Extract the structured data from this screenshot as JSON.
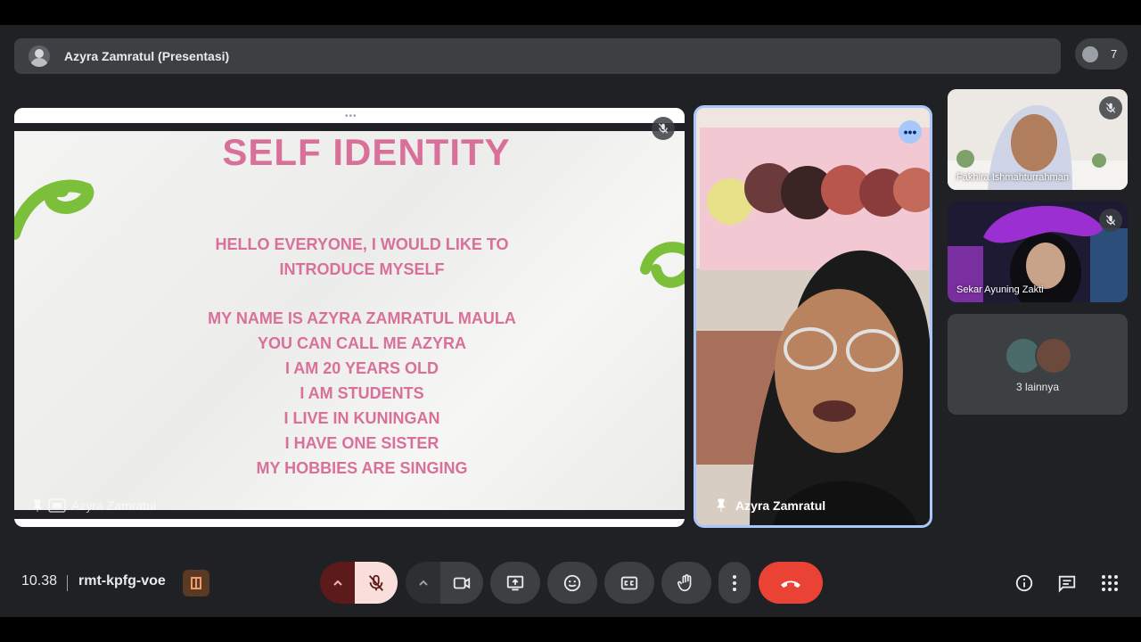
{
  "presenter_bar": {
    "title": "Azyra Zamratul (Presentasi)"
  },
  "participants": {
    "count": "7"
  },
  "slide": {
    "title": "SELF IDENTITY",
    "intro_line1": "HELLO EVERYONE, I WOULD LIKE TO",
    "intro_line2": "INTRODUCE MYSELF",
    "lines": [
      "MY NAME IS AZYRA ZAMRATUL MAULA",
      "YOU CAN CALL ME AZYRA",
      "I AM 20 YEARS OLD",
      "I AM STUDENTS",
      "I LIVE IN KUNINGAN",
      "I HAVE ONE SISTER",
      "MY HOBBIES ARE SINGING"
    ],
    "accent_color": "#d9709a",
    "deco_color": "#7bbf3a"
  },
  "screen_tile": {
    "owner_name": "Azyra Zamratul"
  },
  "speaker": {
    "name": "Azyra Zamratul"
  },
  "side_tiles": [
    {
      "name": "Fakhira Ishmahturrahman"
    },
    {
      "name": "Sekar Ayuning Zakti"
    },
    {
      "name": "3 lainnya"
    }
  ],
  "footer": {
    "time": "10.38",
    "meeting_code": "rmt-kpfg-voe"
  },
  "controls": {
    "mic": "mic-off-icon",
    "camera": "camera-icon",
    "present": "present-icon",
    "emoji": "emoji-icon",
    "captions": "captions-icon",
    "raise_hand": "raise-hand-icon",
    "more": "more-vert-icon",
    "leave": "call-end-icon",
    "leave_color": "#ea4335"
  },
  "right_controls": [
    "info-icon",
    "chat-icon",
    "apps-grid-icon"
  ]
}
